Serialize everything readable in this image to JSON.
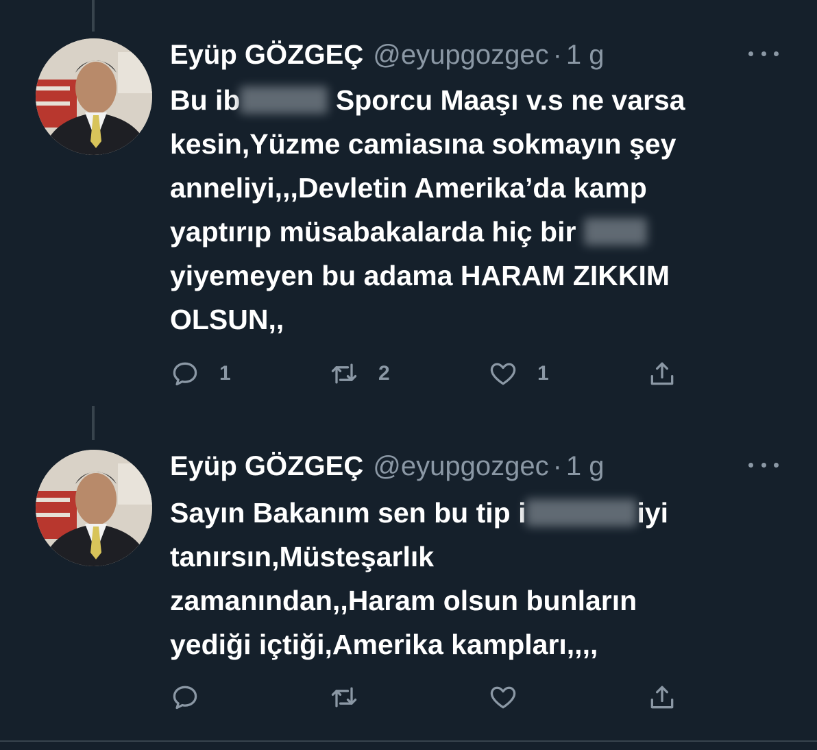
{
  "tweets": [
    {
      "author_name": "Eyüp GÖZGEÇ",
      "handle": "@eyupgozgec",
      "separator": "·",
      "time": "1 g",
      "text_parts": {
        "a": "Bu ib",
        "b": " Sporcu Maaşı v.s ne varsa",
        "c": "kesin,Yüzme camiasına sokmayın şey",
        "d": "anneliyi,,,Devletin Amerika’da kamp",
        "e": "yaptırıp müsabakalarda hiç bir ",
        "f": "yiyemeyen bu adama HARAM ZIKKIM",
        "g": "OLSUN,,"
      },
      "replies": "1",
      "retweets": "2",
      "likes": "1"
    },
    {
      "author_name": "Eyüp GÖZGEÇ",
      "handle": "@eyupgozgec",
      "separator": "·",
      "time": "1 g",
      "text_parts": {
        "a": "Sayın Bakanım sen bu tip i",
        "b": "iyi",
        "c": "tanırsın,Müsteşarlık",
        "d": "zamanından,,Haram olsun bunların",
        "e": "yediği içtiği,Amerika kampları,,,,"
      },
      "replies": "",
      "retweets": "",
      "likes": ""
    }
  ],
  "icons": {
    "reply": "reply-icon",
    "retweet": "retweet-icon",
    "like": "heart-icon",
    "share": "share-icon",
    "more": "more-options-icon"
  },
  "colors": {
    "background": "#15202b",
    "text": "#ffffff",
    "muted": "#8b98a5",
    "border": "#38444d"
  }
}
